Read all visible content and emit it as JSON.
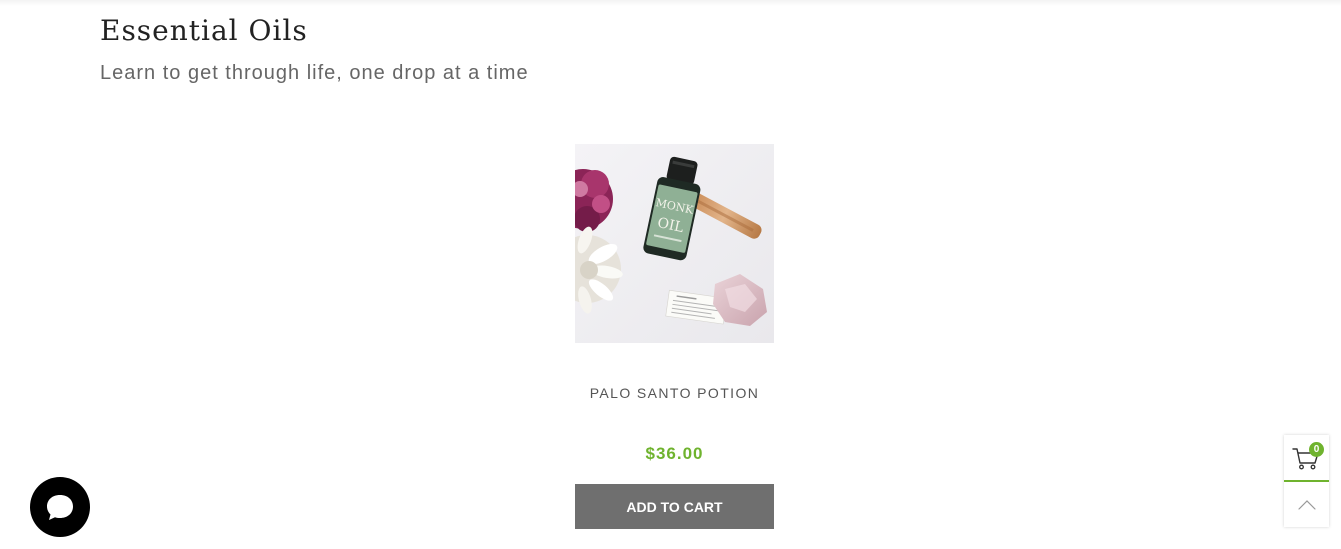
{
  "collection": {
    "title": "Essential Oils",
    "subtitle": "Learn to get through life, one drop at a time"
  },
  "product": {
    "name": "PALO SANTO POTION",
    "price": "$36.00",
    "add_to_cart_label": "ADD TO CART",
    "image_alt": "Palo Santo Potion"
  },
  "bottle_label": {
    "line1": "MONK",
    "line2": "OIL"
  },
  "cart": {
    "count": "0",
    "icon": "cart-icon"
  },
  "widgets": {
    "chat_icon": "chat-bubble-icon",
    "scroll_top_icon": "chevron-up-icon"
  },
  "colors": {
    "accent": "#6fb32e",
    "button": "#6f6f6f",
    "title": "#222222",
    "subtitle": "#666666"
  }
}
